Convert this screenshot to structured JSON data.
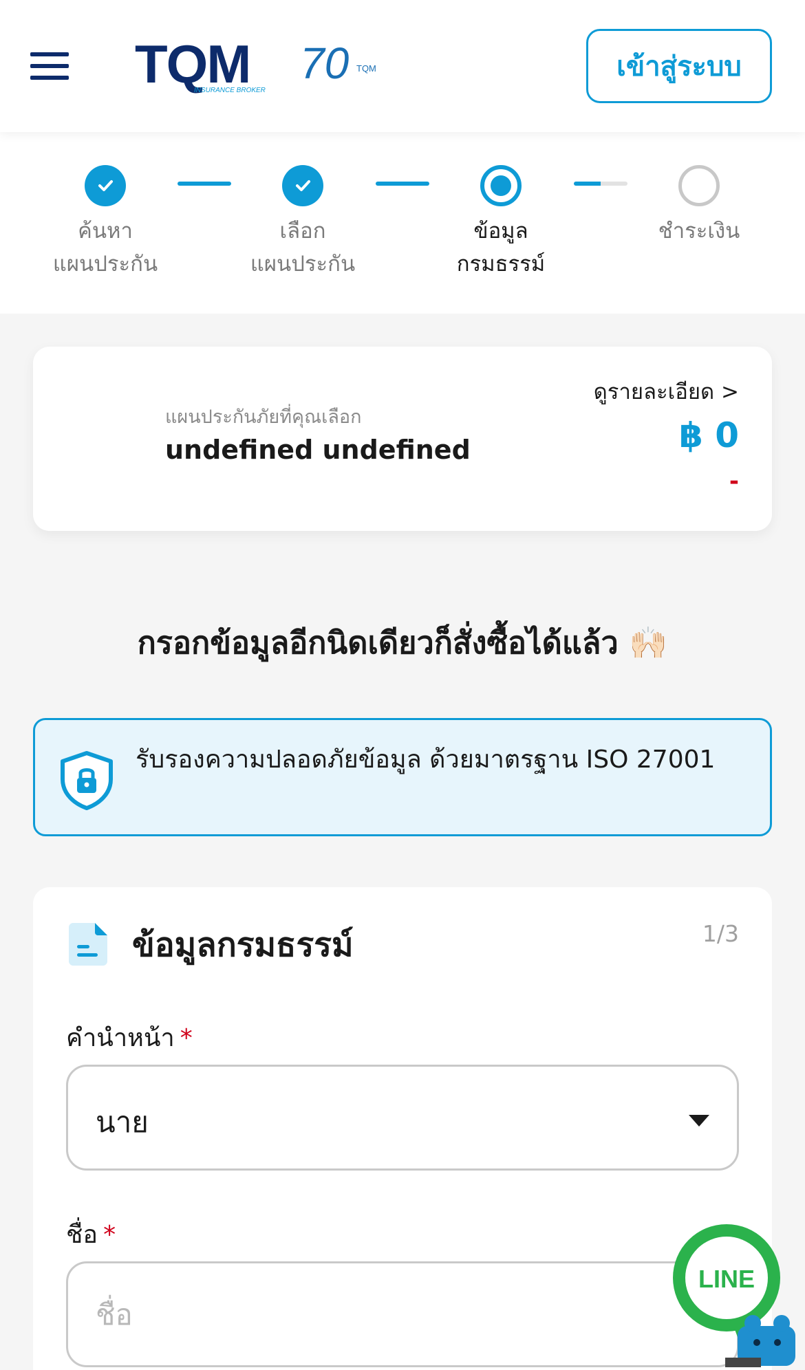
{
  "header": {
    "logo_text": "TQM",
    "logo_sub": "INSURANCE BROKER",
    "anniversary_text": "70",
    "anniversary_sub": "TQM",
    "login_label": "เข้าสู่ระบบ"
  },
  "stepper": {
    "steps": [
      {
        "line1": "ค้นหา",
        "line2": "แผนประกัน",
        "status": "done"
      },
      {
        "line1": "เลือก",
        "line2": "แผนประกัน",
        "status": "done"
      },
      {
        "line1": "ข้อมูล",
        "line2": "กรมธรรม์",
        "status": "current"
      },
      {
        "line1": "ชำระเงิน",
        "line2": "",
        "status": "todo"
      }
    ],
    "connector_fill": [
      1,
      1,
      0.5
    ]
  },
  "plan": {
    "caption": "แผนประกันภัยที่คุณเลือก",
    "name": "undefined undefined",
    "detail_link": "ดูรายละเอียด >",
    "price": "฿ 0",
    "price_sub": "-"
  },
  "headline": "กรอกข้อมูลอีกนิดเดียวก็สั่งซื้อได้แล้ว 🙌🏻",
  "iso": {
    "text": "รับรองความปลอดภัยข้อมูล ด้วยมาตรฐาน ISO 27001"
  },
  "form": {
    "title": "ข้อมูลกรมธรรม์",
    "step": "1/3",
    "fields": {
      "title_label": "คำนำหน้า",
      "title_value": "นาย",
      "name_label": "ชื่อ",
      "name_placeholder": "ชื่อ",
      "required_mark": "*"
    }
  },
  "line_button": {
    "label": "LINE"
  },
  "colors": {
    "accent": "#0e9bd6",
    "navy": "#0d2b6b",
    "required": "#d0021b",
    "line_green": "#2bb24c"
  }
}
